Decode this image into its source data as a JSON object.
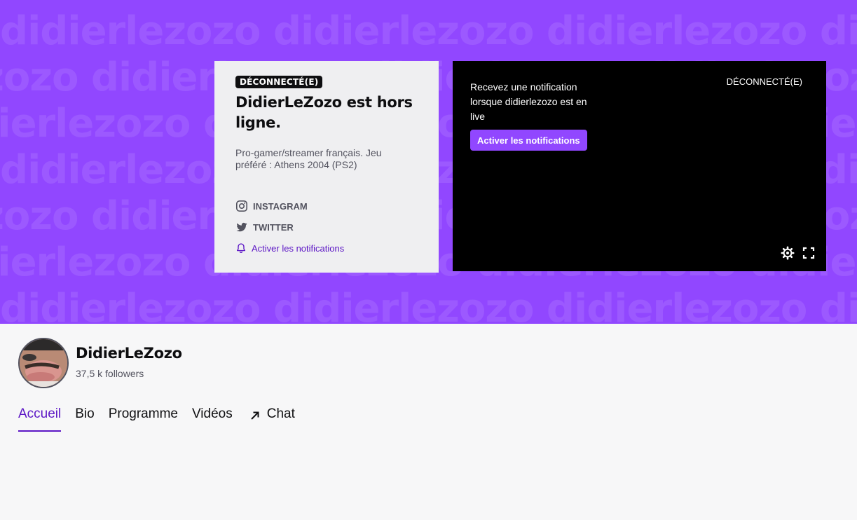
{
  "banner": {
    "watermark_text": "didierlezozo didierlezozo didierlezozo didierlezozo didierlezozo",
    "background_color": "#9147ff"
  },
  "offline_card": {
    "badge": "DÉCONNECTÉ(E)",
    "title": "DidierLeZozo est hors ligne.",
    "description": "Pro-gamer/streamer français. Jeu préféré : Athens 2004 (PS2)",
    "socials": [
      {
        "label": "INSTAGRAM",
        "icon": "instagram-icon"
      },
      {
        "label": "TWITTER",
        "icon": "twitter-icon"
      }
    ],
    "notif_link": "Activer les notifications"
  },
  "player": {
    "message": "Recevez une notification lorsque didierlezozo est en live",
    "button": "Activer les notifications",
    "status": "DÉCONNECTÉ(E)",
    "controls": [
      "settings-icon",
      "fullscreen-icon"
    ]
  },
  "channel": {
    "name": "DidierLeZozo",
    "followers": "37,5 k followers"
  },
  "tabs": [
    {
      "label": "Accueil",
      "active": true
    },
    {
      "label": "Bio"
    },
    {
      "label": "Programme"
    },
    {
      "label": "Vidéos"
    },
    {
      "label": "Chat",
      "icon": "external-arrow-icon"
    }
  ],
  "colors": {
    "accent": "#9147ff",
    "link": "#5c16c5"
  }
}
